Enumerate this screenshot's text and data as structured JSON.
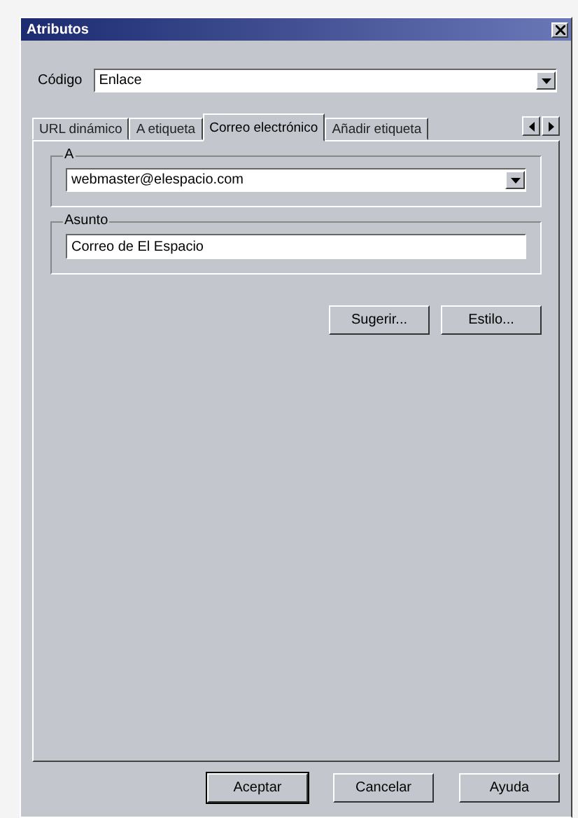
{
  "window": {
    "title": "Atributos"
  },
  "code_field": {
    "label": "Código",
    "value": "Enlace"
  },
  "tabs": [
    {
      "label": "URL dinámico",
      "selected": false
    },
    {
      "label": "A etiqueta",
      "selected": false
    },
    {
      "label": "Correo electrónico",
      "selected": true
    },
    {
      "label": "Añadir etiqueta",
      "selected": false
    }
  ],
  "to_group": {
    "label": "A",
    "value": "webmaster@elespacio.com"
  },
  "subject_group": {
    "label": "Asunto",
    "value": "Correo de El Espacio"
  },
  "panel_buttons": [
    "Sugerir...",
    "Estilo..."
  ],
  "buttons": [
    {
      "label": "Aceptar",
      "default": true
    },
    {
      "label": "Cancelar",
      "default": false
    },
    {
      "label": "Ayuda",
      "default": false
    }
  ]
}
